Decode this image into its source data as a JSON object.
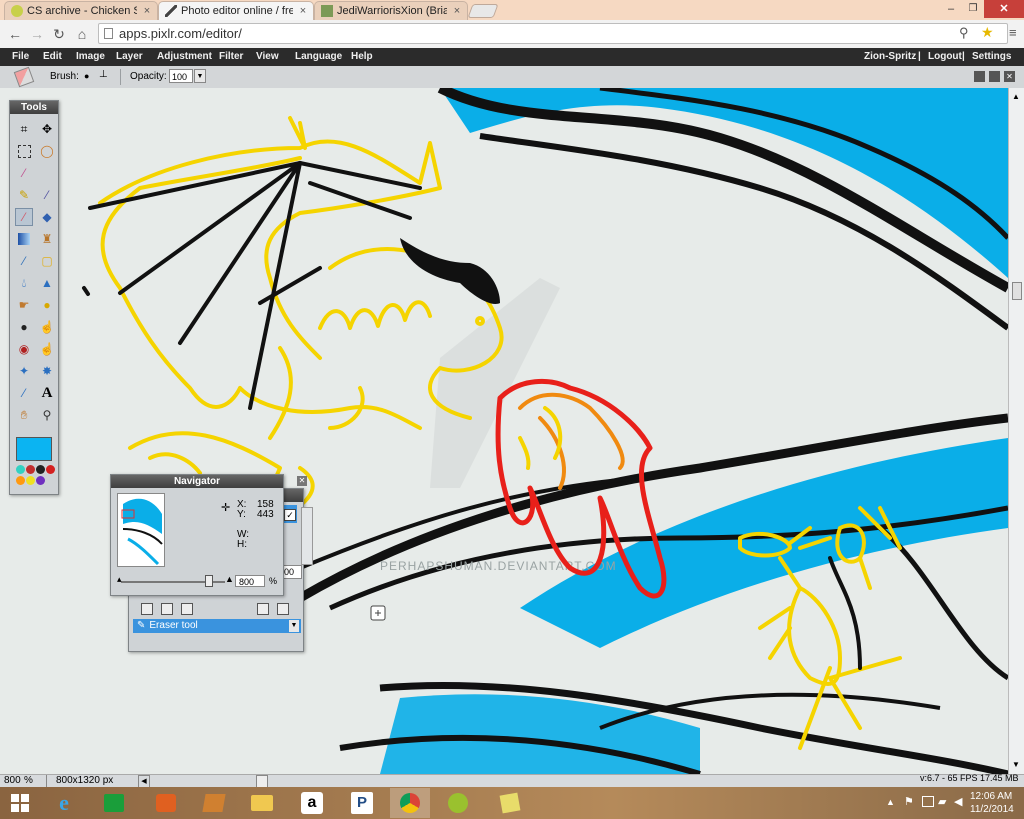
{
  "browser": {
    "tabs": [
      {
        "label": "CS archive - Chicken Smo",
        "close": "×"
      },
      {
        "label": "Photo editor online / free",
        "close": "×"
      },
      {
        "label": "JediWarriorisXion (Brianna",
        "close": "×"
      }
    ],
    "url": "apps.pixlr.com/editor/"
  },
  "app": {
    "menu": [
      "File",
      "Edit",
      "Image",
      "Layer",
      "Adjustment",
      "Filter",
      "View",
      "Language",
      "Help"
    ],
    "user": "Zion-Spritz",
    "logout": "Logout",
    "settings": "Settings",
    "options": {
      "brush_label": "Brush:",
      "opacity_label": "Opacity:",
      "opacity_value": "100"
    }
  },
  "tools": {
    "title": "Tools",
    "fg_color": "#0bb4f2",
    "swatches": [
      "#33d1c2",
      "#c22e2e",
      "#222222",
      "#d42020",
      "#ff9910",
      "#f0e020",
      "#7030c0"
    ]
  },
  "navigator": {
    "title": "Navigator",
    "x_label": "X:",
    "x_value": "158",
    "y_label": "Y:",
    "y_value": "443",
    "w_label": "W:",
    "h_label": "H:",
    "zoom_value": "800",
    "zoom_unit": "%"
  },
  "history": {
    "item": "Eraser tool",
    "value": "100"
  },
  "watermark": "PERHAPSHUMAN.DEVIANTART.COM",
  "status": {
    "zoom": "800",
    "zoom_unit": "%",
    "size": "800x1320 px",
    "version": "v:6.7 - 65 FPS 17.45 MB"
  },
  "taskbar": {
    "time": "12:06 AM",
    "date": "11/2/2014"
  },
  "colors": {
    "yellow": "#f5d400",
    "black": "#111111",
    "red": "#e8201a",
    "orange": "#f08a10",
    "sky": "#0aaee8"
  }
}
